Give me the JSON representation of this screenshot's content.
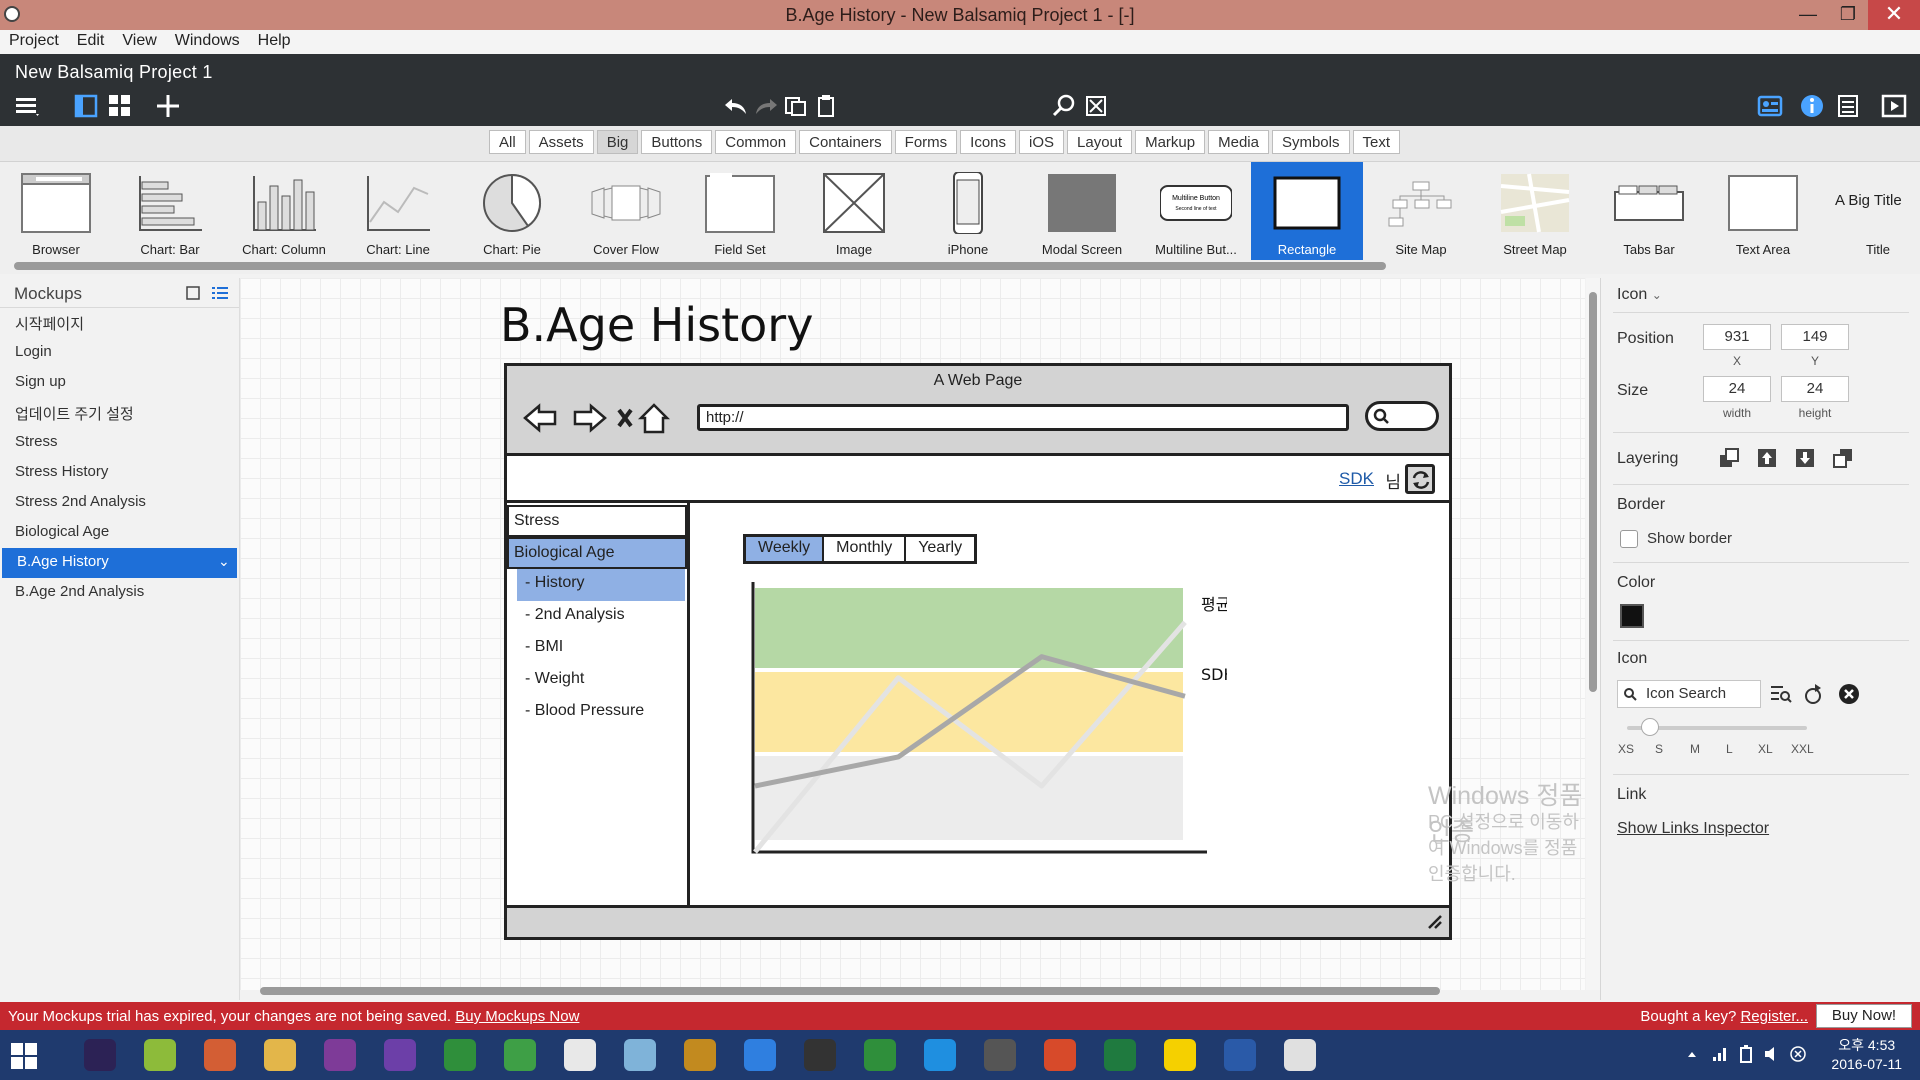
{
  "window": {
    "title": "B.Age History - New Balsamiq Project 1 - [-]",
    "minimize": "—",
    "maximize": "❐",
    "close": "✕"
  },
  "menu": [
    "Project",
    "Edit",
    "View",
    "Windows",
    "Help"
  ],
  "project_name": "New Balsamiq Project 1",
  "categories": [
    "All",
    "Assets",
    "Big",
    "Buttons",
    "Common",
    "Containers",
    "Forms",
    "Icons",
    "iOS",
    "Layout",
    "Markup",
    "Media",
    "Symbols",
    "Text"
  ],
  "active_category": "Big",
  "library": [
    "Browser",
    "Chart: Bar",
    "Chart: Column",
    "Chart: Line",
    "Chart: Pie",
    "Cover Flow",
    "Field Set",
    "Image",
    "iPhone",
    "Modal Screen",
    "Multiline But...",
    "Rectangle",
    "Site Map",
    "Street Map",
    "Tabs Bar",
    "Text Area",
    "Title"
  ],
  "library_extra": {
    "multiline_line1": "Multiline Button",
    "multiline_line2": "Second line of text",
    "title_sample": "A Big Title"
  },
  "active_library_item": "Rectangle",
  "mockups": {
    "header": "Mockups",
    "items": [
      "시작페이지",
      "Login",
      "Sign up",
      "업데이트 주기 설정",
      "Stress",
      "Stress History",
      "Stress 2nd Analysis",
      "Biological Age",
      "B.Age History",
      "B.Age 2nd Analysis"
    ],
    "selected": "B.Age History"
  },
  "mockup": {
    "title": "B.Age History",
    "browser_title": "A Web Page",
    "url": "http://",
    "sdk_link": "SDK",
    "honorific": "님",
    "sidebar": [
      {
        "label": "Stress",
        "style": "box"
      },
      {
        "label": "Biological Age",
        "style": "blue"
      },
      {
        "label": "- History",
        "style": "subsel"
      },
      {
        "label": "- 2nd Analysis",
        "style": "sub"
      },
      {
        "label": "- BMI",
        "style": "sub"
      },
      {
        "label": "- Weight",
        "style": "sub"
      },
      {
        "label": "- Blood Pressure",
        "style": "sub"
      }
    ],
    "tabs": [
      "Weekly",
      "Monthly",
      "Yearly"
    ],
    "active_tab": "Weekly"
  },
  "chart_data": {
    "type": "line",
    "title": "",
    "xlabel": "",
    "ylabel": "",
    "bands": [
      {
        "color": "#b5d8a5"
      },
      {
        "color": "#fce7a0"
      },
      {
        "color": "#ececec"
      }
    ],
    "series": [
      {
        "name": "평균",
        "color": "#e3e3e3",
        "values": [
          0,
          66,
          25,
          87
        ]
      },
      {
        "name": "SDK",
        "color": "#a8a8a8",
        "values": [
          25,
          36,
          74,
          59
        ]
      }
    ],
    "ylim": [
      0,
      100
    ]
  },
  "watermark": {
    "line1": "Windows 정품 인증",
    "line2": "PC 설정으로 이동하여 Windows를 정품 인증합니다."
  },
  "inspector": {
    "type_label": "Icon",
    "position_label": "Position",
    "x": "931",
    "y": "149",
    "x_cap": "X",
    "y_cap": "Y",
    "size_label": "Size",
    "width": "24",
    "height": "24",
    "width_cap": "width",
    "height_cap": "height",
    "layering_label": "Layering",
    "border_label": "Border",
    "show_border": "Show border",
    "color_label": "Color",
    "color_value": "#111111",
    "icon_label": "Icon",
    "icon_search": "Icon Search",
    "sizes": [
      "XS",
      "S",
      "M",
      "L",
      "XL",
      "XXL"
    ],
    "link_label": "Link",
    "show_links": "Show Links Inspector"
  },
  "trial": {
    "message": "Your Mockups trial has expired, your changes are not being saved.",
    "buy_link": "Buy Mockups Now",
    "bought": "Bought a key?",
    "register": "Register...",
    "buy_now": "Buy Now!"
  },
  "taskbar": {
    "apps": [
      "eclipse",
      "notepad",
      "powerpoint",
      "explorer",
      "onenote",
      "visual-studio",
      "evernote",
      "android-studio",
      "chrome",
      "eraser",
      "intellij",
      "internet-explorer",
      "terminal",
      "evernote-2",
      "skype",
      "settings",
      "headphones",
      "excel",
      "kakaotalk",
      "word",
      "smile"
    ],
    "time": "오후 4:53",
    "date": "2016-07-11"
  }
}
